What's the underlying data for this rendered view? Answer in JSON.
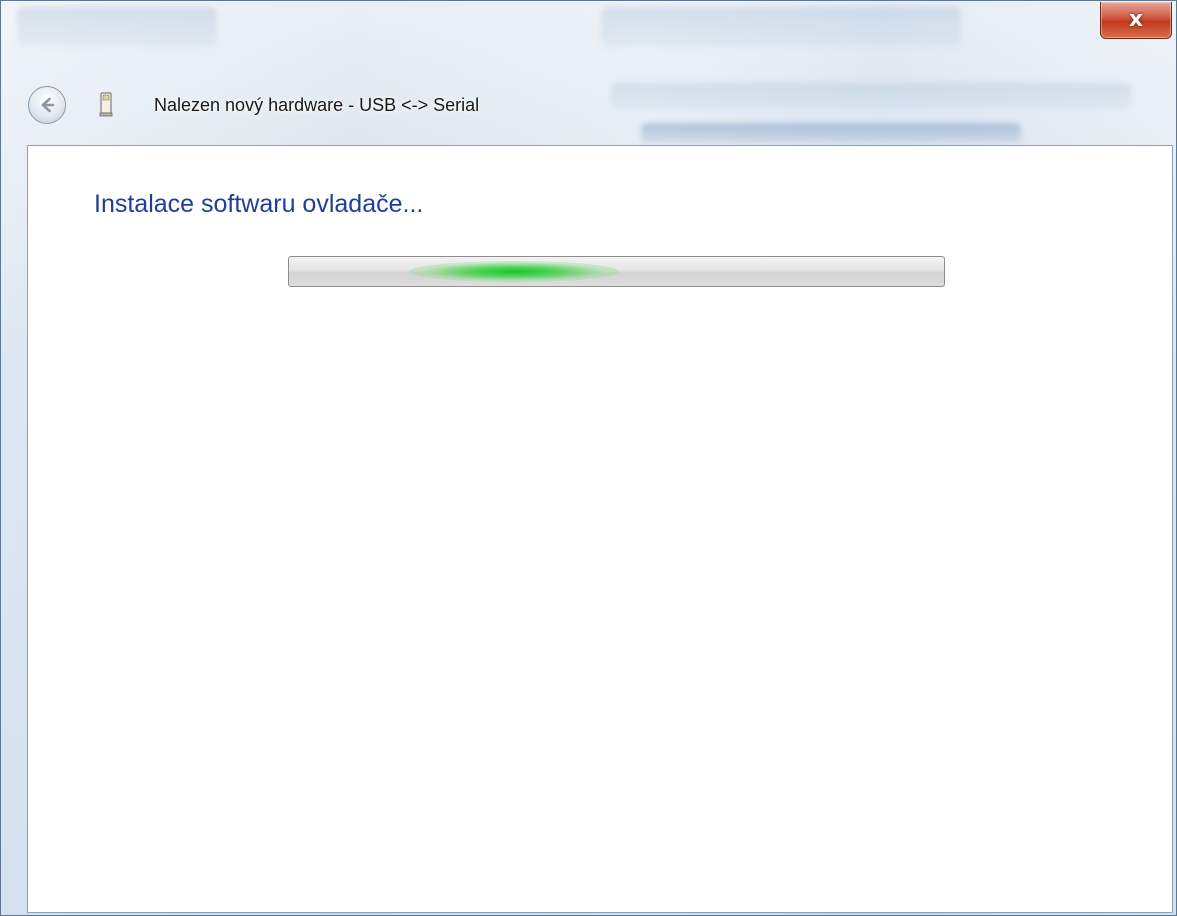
{
  "window": {
    "title": "Nalezen nový hardware - USB <-> Serial",
    "close_label": "x"
  },
  "main": {
    "heading": "Instalace softwaru ovladače..."
  },
  "icons": {
    "back": "back-arrow-icon",
    "device": "usb-device-icon",
    "close": "close-icon"
  },
  "progress": {
    "mode": "indeterminate",
    "color": "#1fcf35"
  },
  "colors": {
    "heading": "#1e3e9a",
    "close_button": "#c23a1f"
  }
}
